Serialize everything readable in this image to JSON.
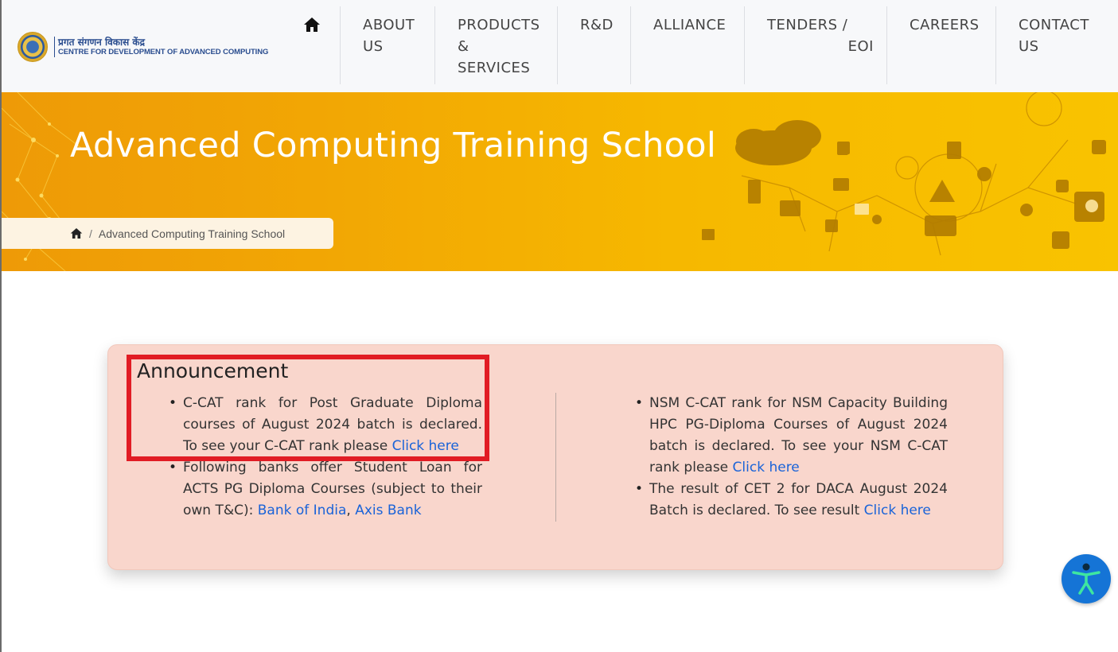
{
  "header": {
    "logo": {
      "hindi": "प्रगत संगणन विकास केंद्र",
      "english": "CENTRE FOR DEVELOPMENT OF ADVANCED COMPUTING"
    },
    "home_icon": "home-icon",
    "nav": [
      {
        "lines": [
          "ABOUT",
          "US"
        ]
      },
      {
        "lines": [
          "PRODUCTS",
          "&",
          "SERVICES"
        ]
      },
      {
        "lines": [
          "R&D"
        ]
      },
      {
        "lines": [
          "ALLIANCE"
        ]
      },
      {
        "lines": [
          "TENDERS /",
          "EOI"
        ]
      },
      {
        "lines": [
          "CAREERS"
        ]
      },
      {
        "lines": [
          "CONTACT",
          "US"
        ]
      }
    ]
  },
  "banner": {
    "title": "Advanced Computing Training School",
    "breadcrumb": {
      "separator": "/",
      "current": "Advanced Computing Training School"
    },
    "accent_color": "#f6b800"
  },
  "announcement": {
    "title": "Announcement",
    "left": [
      {
        "text": "C-CAT rank for Post Graduate Diploma courses of August 2024 batch is declared. To see your C-CAT rank please ",
        "link": "Click here"
      },
      {
        "text": "Following banks offer Student Loan for ACTS PG Diploma Courses (subject to their own T&C): ",
        "link": "Bank of India",
        "sep": ", ",
        "link2": "Axis Bank"
      }
    ],
    "right": [
      {
        "text": "NSM C-CAT rank for NSM Capacity Building HPC PG-Diploma Courses of August 2024 batch is declared. To see your NSM C-CAT rank please ",
        "link": "Click here"
      },
      {
        "text": "The result of CET 2 for DACA August 2024 Batch is declared. To see result ",
        "link": "Click here"
      }
    ],
    "background_color": "#f9d6cc",
    "link_color": "#1a63d8",
    "highlight_color": "#e11c24"
  },
  "accessibility": {
    "icon": "accessibility-icon",
    "color": "#1574d6"
  }
}
